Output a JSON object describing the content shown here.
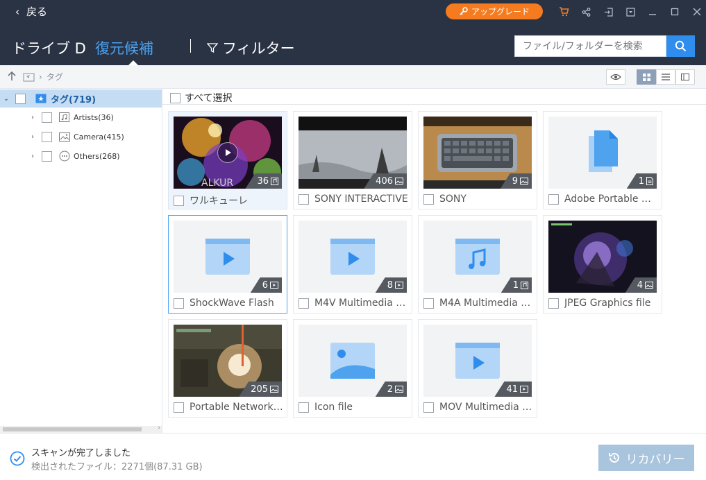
{
  "titlebar": {
    "back_label": "戻る",
    "upgrade_label": "アップグレード",
    "icons": [
      "cart-icon",
      "share-icon",
      "signin-icon",
      "dropdown-icon",
      "minimize-icon",
      "maximize-icon",
      "close-icon"
    ]
  },
  "nav": {
    "drive_label": "ドライブ D",
    "tab_label": "復元候補",
    "filter_label": "フィルター",
    "search_placeholder": "ファイル/フォルダーを検索"
  },
  "path": {
    "crumb": "タグ"
  },
  "sidebar": {
    "root_label": "タグ(719)",
    "items": [
      {
        "label": "Artists(36)",
        "icon": "music-icon"
      },
      {
        "label": "Camera(415)",
        "icon": "image-icon"
      },
      {
        "label": "Others(268)",
        "icon": "more-icon"
      }
    ]
  },
  "content": {
    "select_all_label": "すべて選択",
    "cards": [
      {
        "name": "ワルキューレ",
        "count": "36",
        "badge_icon": "music-icon",
        "thumb": "anime-video"
      },
      {
        "name": "SONY INTERACTIVE",
        "count": "406",
        "badge_icon": "image-icon",
        "thumb": "dark-scene"
      },
      {
        "name": "SONY",
        "count": "9",
        "badge_icon": "image-icon",
        "thumb": "keyboard-photo"
      },
      {
        "name": "Adobe Portable Document",
        "count": "1",
        "badge_icon": "doc-icon",
        "thumb": "doc-placeholder"
      },
      {
        "name": "ShockWave Flash",
        "count": "6",
        "badge_icon": "video-icon",
        "thumb": "video-placeholder"
      },
      {
        "name": "M4V Multimedia file",
        "count": "8",
        "badge_icon": "video-icon",
        "thumb": "video-placeholder"
      },
      {
        "name": "M4A Multimedia file",
        "count": "1",
        "badge_icon": "music-icon",
        "thumb": "audio-placeholder"
      },
      {
        "name": "JPEG Graphics file",
        "count": "4",
        "badge_icon": "image-icon",
        "thumb": "game-scene"
      },
      {
        "name": "Portable Network Graphics",
        "count": "205",
        "badge_icon": "image-icon",
        "thumb": "explosion-scene"
      },
      {
        "name": "Icon file",
        "count": "2",
        "badge_icon": "image-icon",
        "thumb": "image-placeholder"
      },
      {
        "name": "MOV Multimedia file",
        "count": "41",
        "badge_icon": "video-icon",
        "thumb": "video-placeholder"
      }
    ]
  },
  "status": {
    "title": "スキャンが完了しました",
    "found_prefix": "検出されたファイル：",
    "found_value": "2271個(87.31 GB)",
    "recover_label": "リカバリー"
  },
  "colors": {
    "header_bg": "#2a3344",
    "accent_blue": "#4aa3f2",
    "upgrade_orange": "#f47b20",
    "recover_disabled": "#a9c4dd"
  }
}
